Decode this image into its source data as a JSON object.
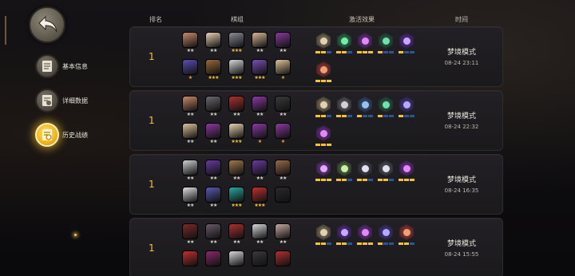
{
  "sidebar": {
    "items": [
      {
        "label": "基本信息",
        "icon": "document-icon",
        "active": false
      },
      {
        "label": "详细数据",
        "icon": "data-detail-icon",
        "active": false
      },
      {
        "label": "历史战绩",
        "icon": "history-icon",
        "active": true
      }
    ]
  },
  "headers": {
    "rank": "排名",
    "board": "棋组",
    "effects": "激活效果",
    "time": "时间"
  },
  "matches": [
    {
      "rank": "1",
      "mode": "梦境模式",
      "datetime": "08-24 23:11",
      "units": [
        {
          "color": "#c98a6a",
          "stars": "★★"
        },
        {
          "color": "#e9d2b2",
          "stars": "★★"
        },
        {
          "color": "#8a8c96",
          "stars": "★★★"
        },
        {
          "color": "#d8b899",
          "stars": "★★"
        },
        {
          "color": "#8a3aa0",
          "stars": "★★"
        },
        {
          "color": "#5a4fb5",
          "stars": "★"
        },
        {
          "color": "#9a6a3a",
          "stars": "★★★"
        },
        {
          "color": "#d9d9dc",
          "stars": "★★★"
        },
        {
          "color": "#7a4fb5",
          "stars": "★★★"
        },
        {
          "color": "#e0c39a",
          "stars": "★"
        }
      ],
      "traits": [
        {
          "color": "#9b8a6a",
          "glyph": "#e0d2b0",
          "bars": [
            1,
            1,
            0
          ]
        },
        {
          "color": "#2c8a5a",
          "glyph": "#6ff0a8",
          "bars": [
            1,
            1,
            0
          ]
        },
        {
          "color": "#7a2fa8",
          "glyph": "#e08af2",
          "bars": [
            1,
            1,
            1
          ]
        },
        {
          "color": "#2a6a4a",
          "glyph": "#6fe0b0",
          "bars": [
            1,
            0,
            0
          ]
        },
        {
          "color": "#5a2fb0",
          "glyph": "#c8a8ff",
          "bars": [
            1,
            0,
            0
          ]
        },
        {
          "color": "#b03a3a",
          "glyph": "#f0a070",
          "bars": [
            1,
            1,
            1
          ]
        }
      ]
    },
    {
      "rank": "1",
      "mode": "梦境模式",
      "datetime": "08-24 22:32",
      "units": [
        {
          "color": "#c98a6a",
          "stars": "★★"
        },
        {
          "color": "#6a6a70",
          "stars": "★★"
        },
        {
          "color": "#b03030",
          "stars": "★★"
        },
        {
          "color": "#8a3aa0",
          "stars": "★★"
        },
        {
          "color": "#3a3a3c",
          "stars": "★★"
        },
        {
          "color": "#e0c39a",
          "stars": "★★"
        },
        {
          "color": "#8a3aa0",
          "stars": "★★"
        },
        {
          "color": "#e9d2b2",
          "stars": "★★★"
        },
        {
          "color": "#8a3aa0",
          "stars": "★"
        },
        {
          "color": "#8a3aa0",
          "stars": "★"
        }
      ],
      "traits": [
        {
          "color": "#9b8a6a",
          "glyph": "#e0d2b0",
          "bars": [
            1,
            1,
            0
          ]
        },
        {
          "color": "#6a6a70",
          "glyph": "#d0d0d6",
          "bars": [
            1,
            1,
            0
          ]
        },
        {
          "color": "#3a5a8a",
          "glyph": "#9ac0f0",
          "bars": [
            1,
            0,
            0
          ]
        },
        {
          "color": "#2a6a4a",
          "glyph": "#6fe0b0",
          "bars": [
            1,
            0,
            0
          ]
        },
        {
          "color": "#4a3aa0",
          "glyph": "#b8a8ff",
          "bars": [
            1,
            0,
            0
          ]
        },
        {
          "color": "#7a2fa8",
          "glyph": "#e08af2",
          "bars": [
            1,
            1,
            1
          ]
        }
      ]
    },
    {
      "rank": "1",
      "mode": "梦境模式",
      "datetime": "08-24 16:35",
      "units": [
        {
          "color": "#d0d0d4",
          "stars": "★★"
        },
        {
          "color": "#6a3aa0",
          "stars": "★★"
        },
        {
          "color": "#a07a4a",
          "stars": "★★"
        },
        {
          "color": "#6a3aa0",
          "stars": "★★"
        },
        {
          "color": "#9a6a4a",
          "stars": "★★"
        },
        {
          "color": "#e0e0e4",
          "stars": "★★"
        },
        {
          "color": "#5a5ab0",
          "stars": "★★"
        },
        {
          "color": "#2aa8a0",
          "stars": "★★★"
        },
        {
          "color": "#c03030",
          "stars": "★★★"
        },
        {
          "color": "#2a2a2c",
          "stars": ""
        }
      ],
      "traits": [
        {
          "color": "#7a3aa0",
          "glyph": "#e0a8ff",
          "bars": [
            1,
            1,
            1
          ]
        },
        {
          "color": "#5a7a4a",
          "glyph": "#c8f0a8",
          "bars": [
            1,
            1,
            0
          ]
        },
        {
          "color": "#4a4a5a",
          "glyph": "#e0e0f0",
          "bars": [
            1,
            1,
            0
          ]
        },
        {
          "color": "#5a5a6a",
          "glyph": "#e0e0f0",
          "bars": [
            1,
            1,
            0
          ]
        },
        {
          "color": "#7a2fa8",
          "glyph": "#e08af2",
          "bars": [
            1,
            1,
            1
          ]
        }
      ]
    },
    {
      "rank": "1",
      "mode": "梦境模式",
      "datetime": "08-24 15:55",
      "units": [
        {
          "color": "#7a2a2a",
          "stars": "★★"
        },
        {
          "color": "#6a5a6a",
          "stars": "★★"
        },
        {
          "color": "#b03030",
          "stars": "★★"
        },
        {
          "color": "#d8d8dc",
          "stars": "★★"
        },
        {
          "color": "#c8a8a0",
          "stars": "★★"
        },
        {
          "color": "#c03030",
          "stars": ""
        },
        {
          "color": "#8a2a6a",
          "stars": ""
        },
        {
          "color": "#d8d8dc",
          "stars": ""
        },
        {
          "color": "#3a3a3c",
          "stars": ""
        },
        {
          "color": "#b03030",
          "stars": ""
        }
      ],
      "traits": [
        {
          "color": "#9b8a6a",
          "glyph": "#e0d2b0",
          "bars": [
            1,
            1,
            0
          ]
        },
        {
          "color": "#5a2fb0",
          "glyph": "#c8a8ff",
          "bars": [
            1,
            1,
            0
          ]
        },
        {
          "color": "#7a2fa8",
          "glyph": "#e08af2",
          "bars": [
            1,
            1,
            1
          ]
        },
        {
          "color": "#4a3aa0",
          "glyph": "#b8a8ff",
          "bars": [
            1,
            0,
            0
          ]
        },
        {
          "color": "#b03a3a",
          "glyph": "#f0a070",
          "bars": [
            1,
            1,
            0
          ]
        }
      ]
    }
  ],
  "colors": {
    "accent": "#f2c23a",
    "bar_active": "#f2c23a",
    "bar_blue": "#3a7ae0"
  }
}
